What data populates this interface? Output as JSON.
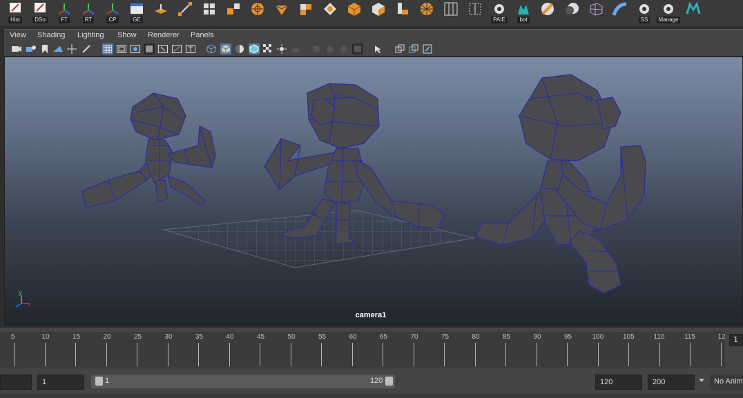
{
  "shelf": {
    "labeled": [
      {
        "label": "Hist",
        "icon": "history-icon"
      },
      {
        "label": "DSo",
        "icon": "delete-history-icon"
      },
      {
        "label": "FT",
        "icon": "freeze-transform-icon"
      },
      {
        "label": "RT",
        "icon": "reset-transform-icon"
      },
      {
        "label": "CP",
        "icon": "center-pivot-icon"
      },
      {
        "label": "GE",
        "icon": "graph-editor-icon"
      },
      {
        "label": "PAIE",
        "icon": "python-icon"
      },
      {
        "label": "bot",
        "icon": "python-icon"
      },
      {
        "label": "SS",
        "icon": "python-icon"
      },
      {
        "label": "Manage",
        "icon": "python-icon"
      }
    ]
  },
  "panel_menu": {
    "view": "View",
    "shading": "Shading",
    "lighting": "Lighting",
    "show": "Show",
    "renderer": "Renderer",
    "panels": "Panels"
  },
  "viewport": {
    "camera_label": "camera1",
    "axis_y": "y",
    "axis_x": "x"
  },
  "timeline": {
    "ticks": [
      "5",
      "10",
      "15",
      "20",
      "25",
      "30",
      "35",
      "40",
      "45",
      "50",
      "55",
      "60",
      "65",
      "70",
      "75",
      "80",
      "85",
      "90",
      "95",
      "100",
      "105",
      "110",
      "115",
      "12"
    ],
    "current_frame": "1"
  },
  "range": {
    "start_field": "1",
    "slider_start": "1",
    "slider_end": "120",
    "end_field": "120",
    "anim_end": "200",
    "anim_layer": "No Anim"
  },
  "colors": {
    "shelf_orange": "#e8902c",
    "selection_blue": "#5b7aa0",
    "wire_blue": "#3a3aa8"
  }
}
